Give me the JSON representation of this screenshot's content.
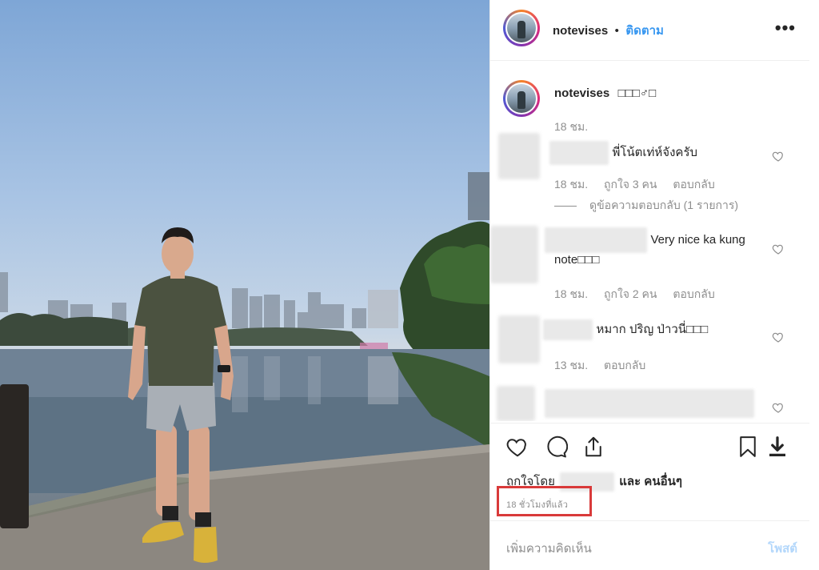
{
  "post": {
    "username": "notevises",
    "separator": "•",
    "follow_label": "ติดตาม",
    "more_label": "•••"
  },
  "caption": {
    "username": "notevises",
    "text": "□□□♂□",
    "time": "18 ชม."
  },
  "comments": [
    {
      "text": "พี่โน้ตเท่ห์จังครับ",
      "time": "18 ชม.",
      "likes": "ถูกใจ 3 คน",
      "reply": "ตอบกลับ",
      "view_replies": "ดูข้อความตอบกลับ (1 รายการ)"
    },
    {
      "text_line1": "Very nice ka kung",
      "text_line2": "note□□□",
      "time": "18 ชม.",
      "likes": "ถูกใจ 2 คน",
      "reply": "ตอบกลับ"
    },
    {
      "text": "หมาก ปริญ ป่าวนี่□□□",
      "time": "13 ชม.",
      "reply": "ตอบกลับ"
    }
  ],
  "likes_line": {
    "prefix": "ถูกใจโดย",
    "suffix": "และ คนอื่นๆ"
  },
  "timestamp": "18 ชั่วโมงที่แล้ว",
  "add_comment": {
    "placeholder": "เพิ่มความคิดเห็น",
    "post_label": "โพสต์"
  },
  "colors": {
    "link": "#3897f0",
    "muted": "#8e8e8e",
    "highlight_box": "#d93a3a"
  },
  "icons": [
    "heart-icon",
    "comment-icon",
    "share-icon",
    "bookmark-icon",
    "download-icon",
    "more-icon"
  ]
}
